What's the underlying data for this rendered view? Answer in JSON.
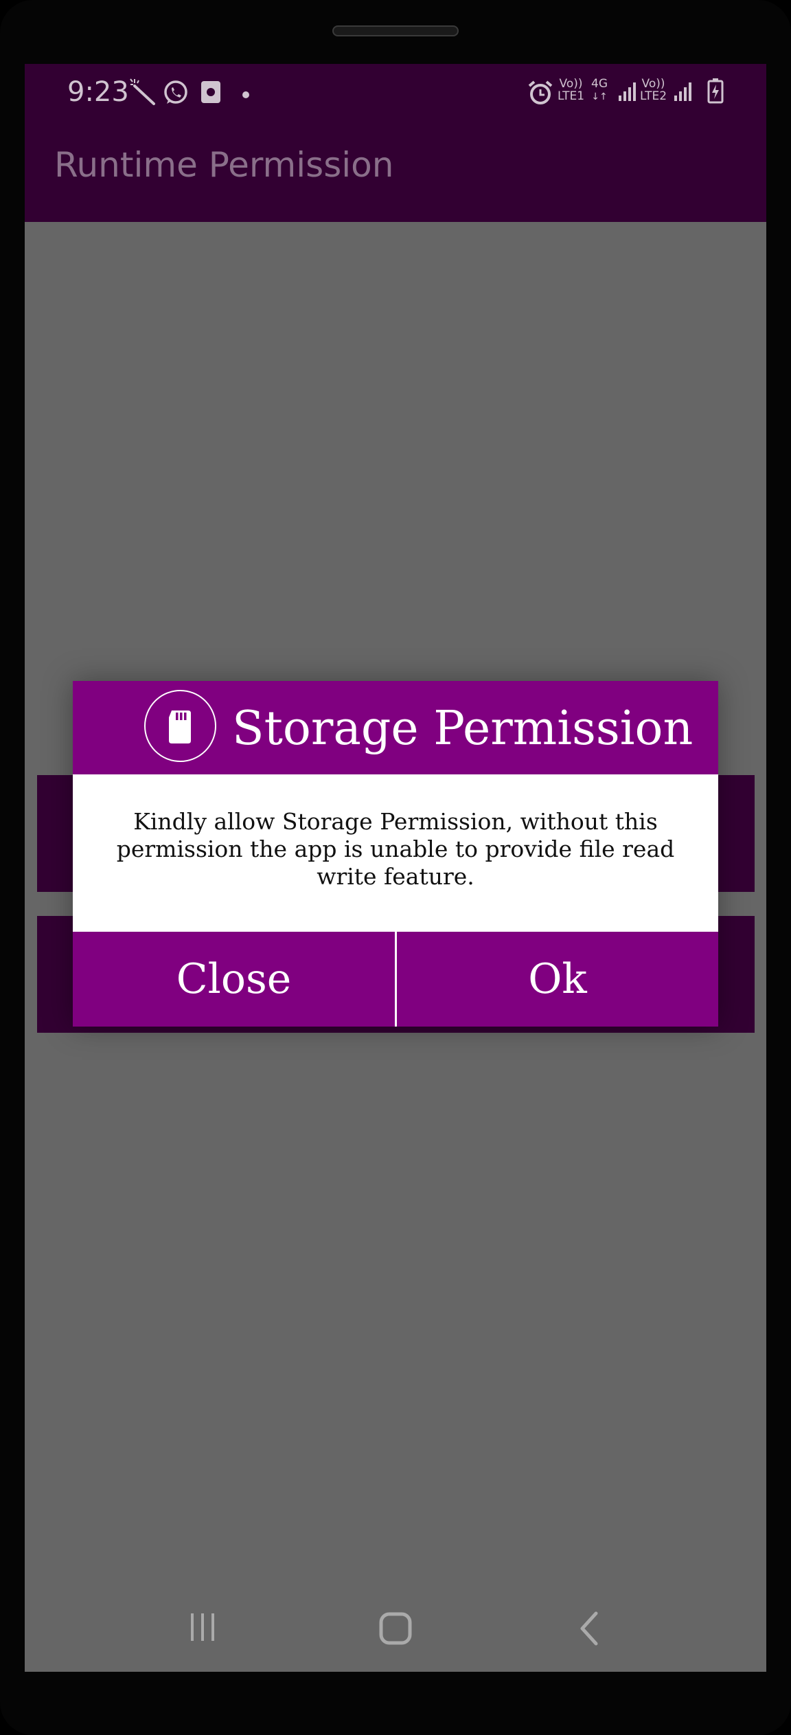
{
  "status_bar": {
    "time": "9:23",
    "left_icons": [
      "magic-wand-icon",
      "whatsapp-icon",
      "sim-storage-icon",
      "notification-dot-icon"
    ],
    "right_icons": [
      "alarm-icon",
      "volte-sim1-icon",
      "4g-data-icon",
      "signal-sim1-icon",
      "volte-sim2-icon",
      "signal-sim2-icon",
      "battery-charging-icon"
    ],
    "sim1_volte": "Vo))",
    "sim1_label": "LTE1",
    "data_type": "4G",
    "sim2_volte": "Vo))",
    "sim2_label": "LTE2"
  },
  "app_bar": {
    "title": "Runtime Permission"
  },
  "dialog": {
    "icon": "sd-card-icon",
    "title": "Storage Permission",
    "message": "Kindly allow Storage Permission, without this permission the app is unable to provide file read write feature.",
    "close_label": "Close",
    "ok_label": "Ok"
  },
  "nav_bar": {
    "icons": [
      "recent-apps-icon",
      "home-icon",
      "back-icon"
    ]
  },
  "colors": {
    "app_bar": "#320032",
    "dialog_accent": "#800080",
    "scrim_background": "#666666"
  }
}
